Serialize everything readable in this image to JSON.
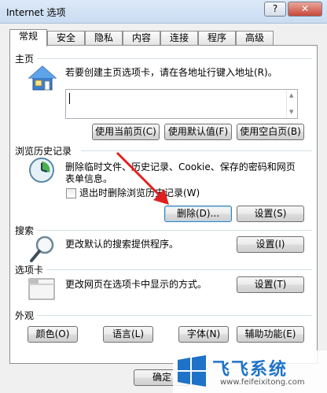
{
  "window": {
    "title": "Internet 选项",
    "help_label": "?",
    "close_label": "✕"
  },
  "tabs": [
    {
      "label": "常规"
    },
    {
      "label": "安全"
    },
    {
      "label": "隐私"
    },
    {
      "label": "内容"
    },
    {
      "label": "连接"
    },
    {
      "label": "程序"
    },
    {
      "label": "高级"
    }
  ],
  "homepage": {
    "title": "主页",
    "description": "若要创建主页选项卡，请在各地址行键入地址(R)。",
    "address_value": "",
    "buttons": {
      "use_current": "使用当前页(C)",
      "use_default": "使用默认值(F)",
      "use_blank": "使用空白页(B)"
    }
  },
  "history": {
    "title": "浏览历史记录",
    "description_line1": "删除临时文件、历史记录、Cookie、保存的密码和网页",
    "description_line2": "表单信息。",
    "checkbox_label": "退出时删除浏览历史记录(W)",
    "checkbox_checked": false,
    "delete_button": "删除(D)...",
    "settings_button": "设置(S)"
  },
  "search": {
    "title": "搜索",
    "description": "更改默认的搜索提供程序。",
    "settings_button": "设置(I)"
  },
  "tabs_section": {
    "title": "选项卡",
    "description": "更改网页在选项卡中显示的方式。",
    "settings_button": "设置(T)"
  },
  "appearance": {
    "title": "外观",
    "buttons": {
      "colors": "颜色(O)",
      "languages": "语言(L)",
      "fonts": "字体(N)",
      "accessibility": "辅助功能(E)"
    }
  },
  "footer": {
    "ok_button": "确定"
  },
  "watermark": {
    "title": "飞飞系统",
    "url": "www.feifeixitong.com"
  },
  "colors": {
    "arrow": "#e02020",
    "accent": "#1e73c8"
  }
}
